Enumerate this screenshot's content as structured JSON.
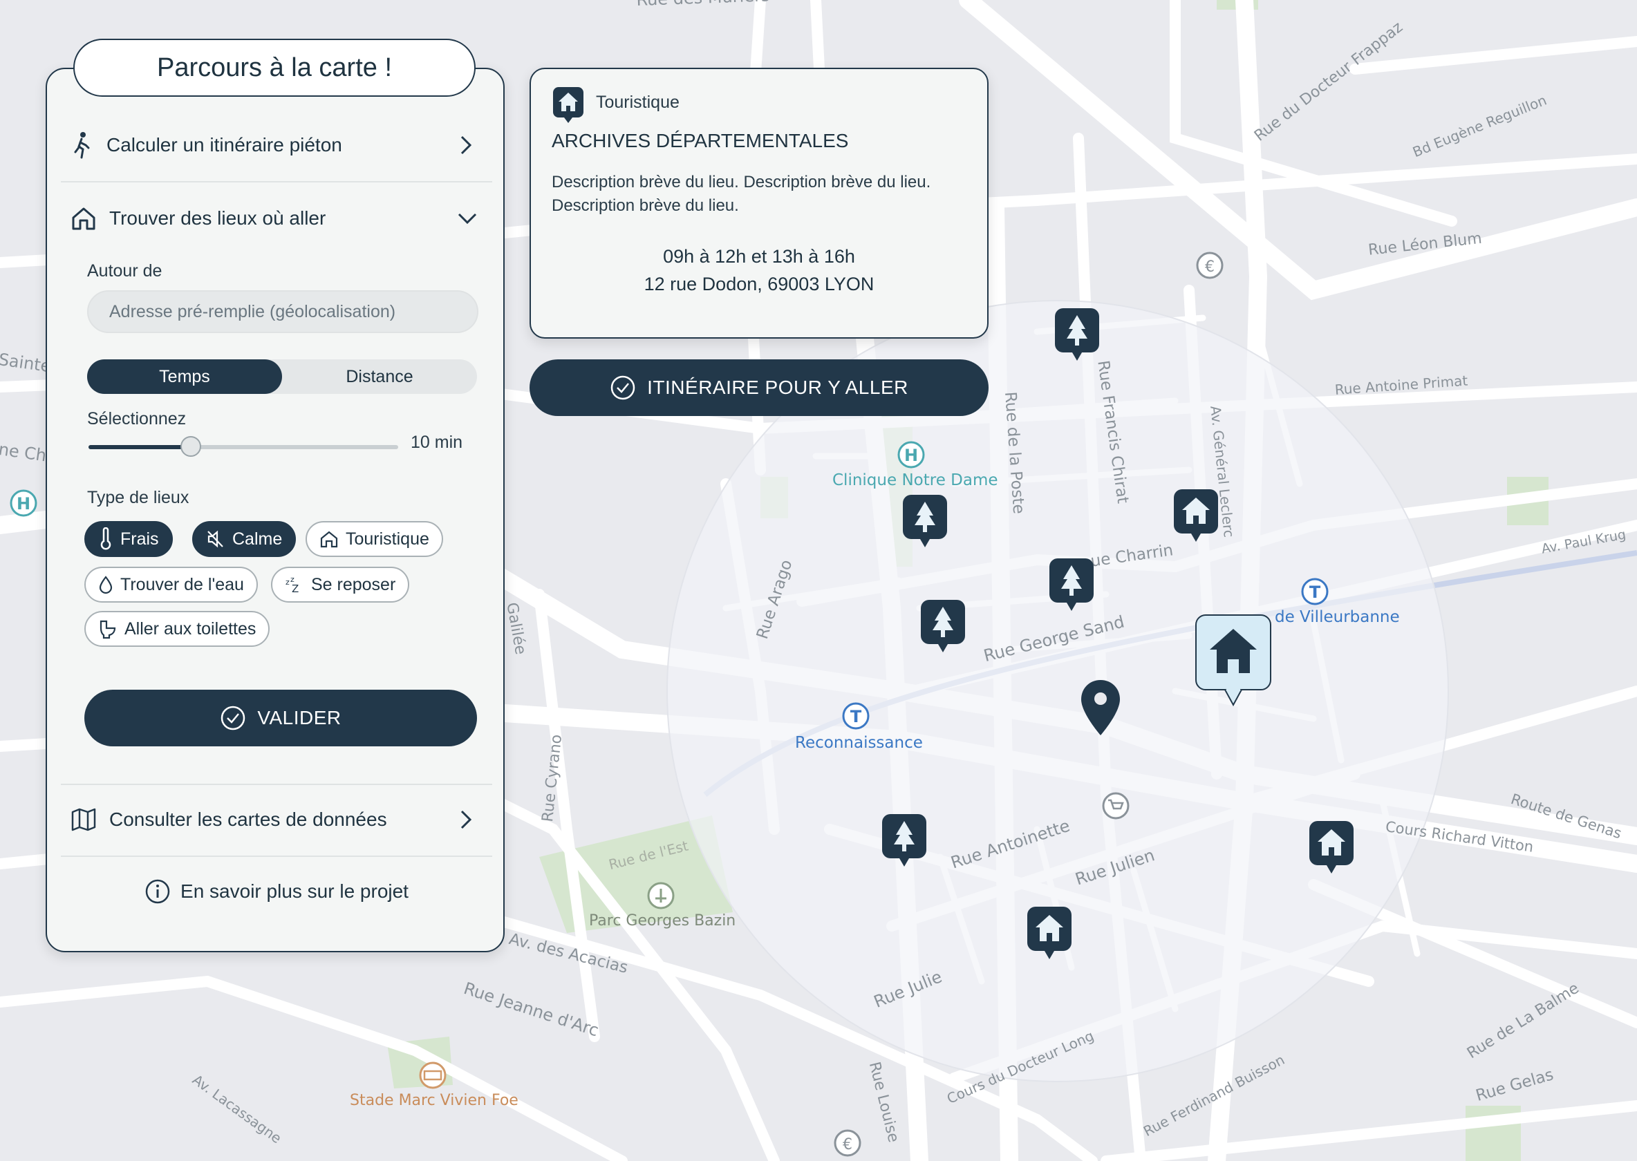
{
  "panel": {
    "title": "Parcours à la carte !",
    "walk_route": "Calculer un itinéraire piéton",
    "find_places": "Trouver des lieux où aller",
    "around_label": "Autour de",
    "address_placeholder": "Adresse pré-remplie (géolocalisation)",
    "mode_time": "Temps",
    "mode_distance": "Distance",
    "active_mode": "Temps",
    "select_label": "Sélectionnez",
    "slider_value": "10 min",
    "slider_fraction": 0.33,
    "place_type_label": "Type de lieux",
    "chips": [
      {
        "label": "Frais",
        "icon": "thermometer-icon",
        "selected": true
      },
      {
        "label": "Calme",
        "icon": "mute-icon",
        "selected": true
      },
      {
        "label": "Touristique",
        "icon": "house-icon",
        "selected": false
      },
      {
        "label": "Trouver de l'eau",
        "icon": "water-drop-icon",
        "selected": false
      },
      {
        "label": "Se reposer",
        "icon": "sleep-icon",
        "selected": false
      },
      {
        "label": "Aller aux toilettes",
        "icon": "toilet-icon",
        "selected": false
      }
    ],
    "validate": "VALIDER",
    "data_maps": "Consulter les cartes de données",
    "about": "En savoir plus sur le projet"
  },
  "popup": {
    "category": "Touristique",
    "name": "ARCHIVES DÉPARTEMENTALES",
    "description_1": "Description brève du lieu. Description brève du lieu.",
    "description_2": "Description brève du lieu.",
    "hours": "09h à 12h et 13h à 16h",
    "address": "12 rue Dodon, 69003 LYON",
    "route_button": "ITINÉRAIRE POUR Y ALLER"
  },
  "map": {
    "colors": {
      "background": "#e9eaee",
      "road": "#ffffff",
      "park": "#d6e6cf",
      "accent": "#22384a",
      "transit": "#3b78c4",
      "hospital": "#4aa8b0"
    },
    "poi": {
      "hospital": "Clinique Notre Dame",
      "transit_1": "Reconnaissance",
      "transit_2": "de Villeurbanne",
      "park": "Parc Georges Bazin",
      "stadium": "Stade Marc Vivien Foe"
    },
    "streets": {
      "s1": "Rue du Docteur Frappaz",
      "s2": "Bd Eugène Reguillon",
      "s3": "Rue Léon Blum",
      "s4": "Rue Antoine Primat",
      "s5": "Av. Paul Krug",
      "s6": "Rue Francis Chirat",
      "s7": "Rue de la Poste",
      "s8": "Av. Général Leclerc",
      "s9": "ue Charrin",
      "s10": "Rue George Sand",
      "s11": "Rue Arago",
      "s12": "Rue Cyrano",
      "s13": "Rue de l'Est",
      "s14": "Av. des Acacias",
      "s15": "Rue Jeanne d'Arc",
      "s16": "Av. Lacassagne",
      "s17": "Rue Antoinette",
      "s18": "Rue Julien",
      "s19": "Rue Julie",
      "s20": "Cours du Docteur Long",
      "s21": "Rue Louise",
      "s22": "Rue Ferdinand Buisson",
      "s23": "Rue de La Balme",
      "s24": "Rue Gelas",
      "s25": "Route de Genas",
      "s26": "Cours Richard Vitton",
      "s27": "Rue des Mûriers",
      "s28": "Galilée",
      "s29": "Sainte",
      "s30": "ne Ch"
    }
  }
}
